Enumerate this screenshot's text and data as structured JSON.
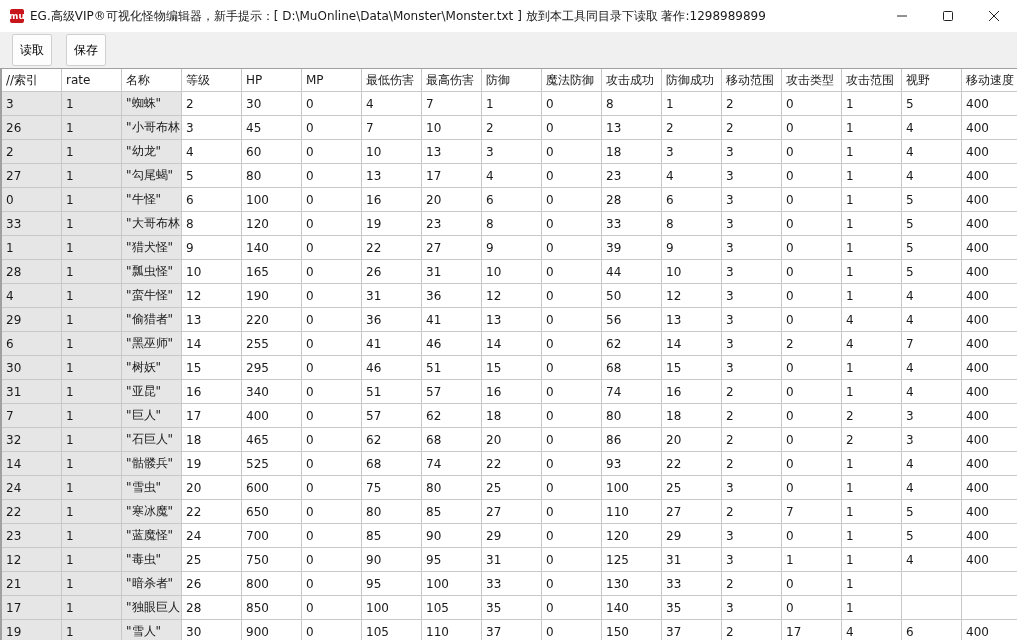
{
  "window": {
    "app_icon_text": "mu",
    "title": "EG.高级VIP®可视化怪物编辑器，新手提示：[ D:\\MuOnline\\Data\\Monster\\Monster.txt ] 放到本工具同目录下读取 著作:1298989899"
  },
  "toolbar": {
    "buttons": [
      "读取",
      "保存"
    ]
  },
  "table": {
    "columns": [
      {
        "label": "//索引",
        "readonly": true
      },
      {
        "label": "rate",
        "readonly": true
      },
      {
        "label": "名称",
        "readonly": true
      },
      {
        "label": "等级",
        "readonly": false
      },
      {
        "label": "HP",
        "readonly": false
      },
      {
        "label": "MP",
        "readonly": false
      },
      {
        "label": "最低伤害",
        "readonly": false
      },
      {
        "label": "最高伤害",
        "readonly": false
      },
      {
        "label": "防御",
        "readonly": false
      },
      {
        "label": "魔法防御",
        "readonly": false
      },
      {
        "label": "攻击成功",
        "readonly": false
      },
      {
        "label": "防御成功",
        "readonly": false
      },
      {
        "label": "移动范围",
        "readonly": false
      },
      {
        "label": "攻击类型",
        "readonly": false
      },
      {
        "label": "攻击范围",
        "readonly": false
      },
      {
        "label": "视野",
        "readonly": false
      },
      {
        "label": "移动速度",
        "readonly": false
      }
    ],
    "rows": [
      [
        "3",
        "1",
        "\"蜘蛛\"",
        "2",
        "30",
        "0",
        "4",
        "7",
        "1",
        "0",
        "8",
        "1",
        "2",
        "0",
        "1",
        "5",
        "400"
      ],
      [
        "26",
        "1",
        "\"小哥布林",
        "3",
        "45",
        "0",
        "7",
        "10",
        "2",
        "0",
        "13",
        "2",
        "2",
        "0",
        "1",
        "4",
        "400"
      ],
      [
        "2",
        "1",
        "\"幼龙\"",
        "4",
        "60",
        "0",
        "10",
        "13",
        "3",
        "0",
        "18",
        "3",
        "3",
        "0",
        "1",
        "4",
        "400"
      ],
      [
        "27",
        "1",
        "\"勾尾蝎\"",
        "5",
        "80",
        "0",
        "13",
        "17",
        "4",
        "0",
        "23",
        "4",
        "3",
        "0",
        "1",
        "4",
        "400"
      ],
      [
        "0",
        "1",
        "\"牛怪\"",
        "6",
        "100",
        "0",
        "16",
        "20",
        "6",
        "0",
        "28",
        "6",
        "3",
        "0",
        "1",
        "5",
        "400"
      ],
      [
        "33",
        "1",
        "\"大哥布林",
        "8",
        "120",
        "0",
        "19",
        "23",
        "8",
        "0",
        "33",
        "8",
        "3",
        "0",
        "1",
        "5",
        "400"
      ],
      [
        "1",
        "1",
        "\"猎犬怪\"",
        "9",
        "140",
        "0",
        "22",
        "27",
        "9",
        "0",
        "39",
        "9",
        "3",
        "0",
        "1",
        "5",
        "400"
      ],
      [
        "28",
        "1",
        "\"瓢虫怪\"",
        "10",
        "165",
        "0",
        "26",
        "31",
        "10",
        "0",
        "44",
        "10",
        "3",
        "0",
        "1",
        "5",
        "400"
      ],
      [
        "4",
        "1",
        "\"蛮牛怪\"",
        "12",
        "190",
        "0",
        "31",
        "36",
        "12",
        "0",
        "50",
        "12",
        "3",
        "0",
        "1",
        "4",
        "400"
      ],
      [
        "29",
        "1",
        "\"偷猎者\"",
        "13",
        "220",
        "0",
        "36",
        "41",
        "13",
        "0",
        "56",
        "13",
        "3",
        "0",
        "4",
        "4",
        "400"
      ],
      [
        "6",
        "1",
        "\"黑巫师\"",
        "14",
        "255",
        "0",
        "41",
        "46",
        "14",
        "0",
        "62",
        "14",
        "3",
        "2",
        "4",
        "7",
        "400"
      ],
      [
        "30",
        "1",
        "\"树妖\"",
        "15",
        "295",
        "0",
        "46",
        "51",
        "15",
        "0",
        "68",
        "15",
        "3",
        "0",
        "1",
        "4",
        "400"
      ],
      [
        "31",
        "1",
        "\"亚昆\"",
        "16",
        "340",
        "0",
        "51",
        "57",
        "16",
        "0",
        "74",
        "16",
        "2",
        "0",
        "1",
        "4",
        "400"
      ],
      [
        "7",
        "1",
        "\"巨人\"",
        "17",
        "400",
        "0",
        "57",
        "62",
        "18",
        "0",
        "80",
        "18",
        "2",
        "0",
        "2",
        "3",
        "400"
      ],
      [
        "32",
        "1",
        "\"石巨人\"",
        "18",
        "465",
        "0",
        "62",
        "68",
        "20",
        "0",
        "86",
        "20",
        "2",
        "0",
        "2",
        "3",
        "400"
      ],
      [
        "14",
        "1",
        "\"骷髅兵\"",
        "19",
        "525",
        "0",
        "68",
        "74",
        "22",
        "0",
        "93",
        "22",
        "2",
        "0",
        "1",
        "4",
        "400"
      ],
      [
        "24",
        "1",
        "\"雪虫\"",
        "20",
        "600",
        "0",
        "75",
        "80",
        "25",
        "0",
        "100",
        "25",
        "3",
        "0",
        "1",
        "4",
        "400"
      ],
      [
        "22",
        "1",
        "\"寒冰魔\"",
        "22",
        "650",
        "0",
        "80",
        "85",
        "27",
        "0",
        "110",
        "27",
        "2",
        "7",
        "1",
        "5",
        "400"
      ],
      [
        "23",
        "1",
        "\"蓝魔怪\"",
        "24",
        "700",
        "0",
        "85",
        "90",
        "29",
        "0",
        "120",
        "29",
        "3",
        "0",
        "1",
        "5",
        "400"
      ],
      [
        "12",
        "1",
        "\"毒虫\"",
        "25",
        "750",
        "0",
        "90",
        "95",
        "31",
        "0",
        "125",
        "31",
        "3",
        "1",
        "1",
        "4",
        "400"
      ],
      [
        "21",
        "1",
        "\"暗杀者\"",
        "26",
        "800",
        "0",
        "95",
        "100",
        "33",
        "0",
        "130",
        "33",
        "2",
        "0",
        "1",
        null,
        null
      ],
      [
        "17",
        "1",
        "\"独眼巨人",
        "28",
        "850",
        "0",
        "100",
        "105",
        "35",
        "0",
        "140",
        "35",
        "3",
        "0",
        "1",
        null,
        null
      ],
      [
        "19",
        "1",
        "\"雪人\"",
        "30",
        "900",
        "0",
        "105",
        "110",
        "37",
        "0",
        "150",
        "37",
        "2",
        "17",
        "4",
        "6",
        "400"
      ]
    ]
  }
}
